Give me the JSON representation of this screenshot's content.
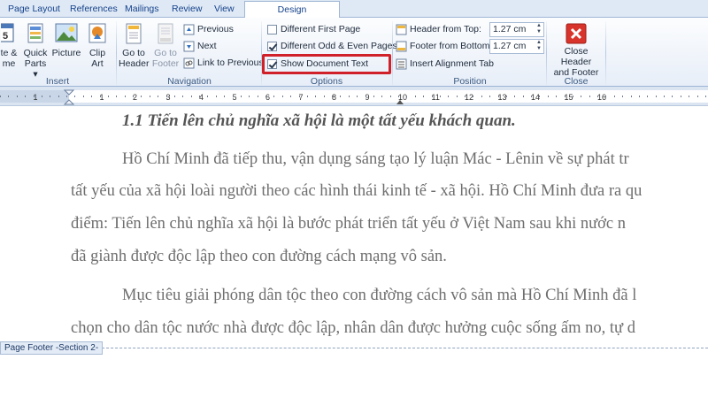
{
  "tabs": [
    {
      "label": "Page Layout",
      "active": false
    },
    {
      "label": "References",
      "active": false
    },
    {
      "label": "Mailings",
      "active": false
    },
    {
      "label": "Review",
      "active": false
    },
    {
      "label": "View",
      "active": false
    },
    {
      "label": "Design",
      "active": true
    }
  ],
  "ribbon": {
    "insert": {
      "label": "Insert",
      "date_time_partial": "te &",
      "date_time_partial2": "me",
      "quick_parts": [
        "Quick",
        "Parts ▾"
      ],
      "picture": "Picture",
      "clip_art": [
        "Clip",
        "Art"
      ]
    },
    "navigation": {
      "label": "Navigation",
      "go_to_header": [
        "Go to",
        "Header"
      ],
      "go_to_footer": [
        "Go to",
        "Footer"
      ],
      "previous": "Previous",
      "next": "Next",
      "link_to_previous": "Link to Previous"
    },
    "options": {
      "label": "Options",
      "different_first_page": "Different First Page",
      "different_odd_even": "Different Odd & Even Pages",
      "show_document_text": "Show Document Text",
      "different_first_page_checked": false,
      "different_odd_even_checked": true,
      "show_document_text_checked": true
    },
    "position": {
      "label": "Position",
      "header_from_top_label": "Header from Top:",
      "header_from_top_value": "1.27 cm",
      "footer_from_bottom_label": "Footer from Bottom:",
      "footer_from_bottom_value": "1.27 cm",
      "insert_alignment_tab": "Insert Alignment Tab"
    },
    "close": {
      "label": "Close",
      "close_button": [
        "Close Header",
        "and Footer"
      ]
    }
  },
  "ruler": {
    "numbers": [
      "1",
      "1",
      "2",
      "3",
      "4",
      "5",
      "6",
      "7",
      "8",
      "9",
      "10",
      "11",
      "12",
      "13",
      "14",
      "15",
      "16"
    ]
  },
  "document": {
    "heading": "1.1 Tiến lên chủ nghĩa xã hội là một tất yếu khách quan.",
    "paragraph1": [
      "Hồ Chí Minh đã tiếp thu, vận dụng sáng tạo lý luận Mác - Lênin về sự phát tr",
      "tất yếu của xã hội loài người theo các hình thái kinh tế - xã hội. Hồ Chí Minh đưa ra qu",
      "điểm: Tiến lên chủ nghĩa xã hội là bước phát triển tất yếu ở Việt Nam sau khi nước n",
      "đã giành được độc lập theo con đường cách mạng vô sản."
    ],
    "paragraph2": [
      "Mục tiêu giải phóng dân tộc theo con đường cách vô sản mà Hồ Chí Minh đã l",
      "chọn cho dân tộc nước nhà được độc lập, nhân dân được hưởng cuộc sống ấm no, tự d"
    ],
    "footer_tag": "Page Footer -Section 2-"
  },
  "colors": {
    "highlight_box": "#d0202a",
    "tab_text": "#15428b",
    "ribbon_bg": "#e7eef8"
  }
}
